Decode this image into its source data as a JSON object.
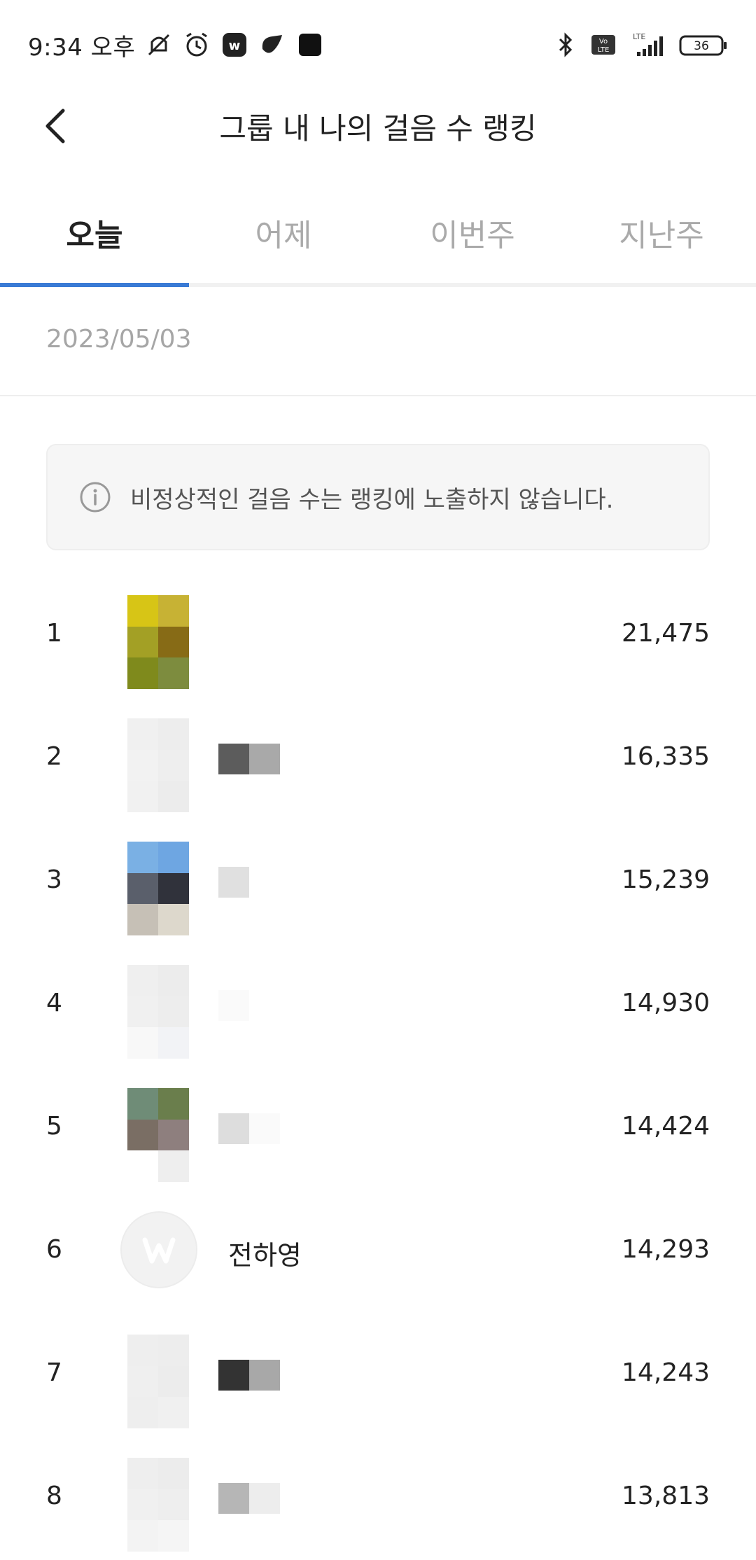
{
  "status_bar": {
    "time": "9:34 오후",
    "battery": "36",
    "network": "LTE",
    "volte": "Vo LTE",
    "icons": [
      "mute-vibrate-icon",
      "alarm-icon",
      "w-app-icon",
      "notification-icon",
      "app-icon",
      "bluetooth-icon",
      "signal-icon",
      "battery-icon"
    ]
  },
  "header": {
    "title": "그룹 내 나의 걸음 수 랭킹",
    "back_icon": "chevron-left-icon"
  },
  "tabs": [
    {
      "label": "오늘",
      "active": true
    },
    {
      "label": "어제",
      "active": false
    },
    {
      "label": "이번주",
      "active": false
    },
    {
      "label": "지난주",
      "active": false
    }
  ],
  "date": "2023/05/03",
  "notice": {
    "icon": "info-icon",
    "text": "비정상적인 걸음 수는 랭킹에 노출하지 않습니다."
  },
  "ranking": [
    {
      "rank": "1",
      "name": "",
      "steps": "21,475",
      "avatar": "mosaic",
      "avatar_colors": [
        "#d7c516",
        "#c7b234",
        "#a3a025",
        "#876b16",
        "#7f8a1c",
        "#7d8c3e"
      ],
      "name_colors": []
    },
    {
      "rank": "2",
      "name": "",
      "steps": "16,335",
      "avatar": "mosaic",
      "avatar_colors": [
        "#f0f0f0",
        "#ededed",
        "#f2f2f2",
        "#eeeeee",
        "#f1f1f1",
        "#ececec"
      ],
      "name_colors": [
        "#5c5c5c",
        "#a9a9a9"
      ]
    },
    {
      "rank": "3",
      "name": "",
      "steps": "15,239",
      "avatar": "mosaic",
      "avatar_colors": [
        "#7ab0e4",
        "#6ea6e2",
        "#5a5f6b",
        "#30323b",
        "#c6c0b6",
        "#ddd8cc"
      ],
      "name_colors": [
        "#e0e0e0"
      ]
    },
    {
      "rank": "4",
      "name": "",
      "steps": "14,930",
      "avatar": "mosaic",
      "avatar_colors": [
        "#efefef",
        "#ececec",
        "#f0f0f0",
        "#ededed",
        "#f8f8f8",
        "#f2f3f6"
      ],
      "name_colors": [
        "#fafafa"
      ]
    },
    {
      "rank": "5",
      "name": "",
      "steps": "14,424",
      "avatar": "mosaic",
      "avatar_colors": [
        "#6f8c77",
        "#6a7e4c",
        "#7a6e64",
        "#8e7f7e",
        "#ffffff",
        "#eeeeee"
      ],
      "name_colors": [
        "#dddddd",
        "#fafafa"
      ]
    },
    {
      "rank": "6",
      "name": "전하영",
      "steps": "14,293",
      "avatar": "w-logo",
      "avatar_colors": [],
      "name_colors": []
    },
    {
      "rank": "7",
      "name": "",
      "steps": "14,243",
      "avatar": "mosaic",
      "avatar_colors": [
        "#eeeeee",
        "#ededed",
        "#efefef",
        "#ececec",
        "#eeeeee",
        "#f0f0f0"
      ],
      "name_colors": [
        "#333333",
        "#a8a8a8"
      ]
    },
    {
      "rank": "8",
      "name": "",
      "steps": "13,813",
      "avatar": "mosaic",
      "avatar_colors": [
        "#eeeeee",
        "#ececec",
        "#f0f0f0",
        "#eeeeee",
        "#f3f3f3",
        "#f5f5f5"
      ],
      "name_colors": [
        "#b6b6b6",
        "#ededed"
      ]
    }
  ],
  "colors": {
    "accent": "#3a7bd5",
    "inactive_tab": "#aaaaaa",
    "date_text": "#a6a6a6"
  }
}
